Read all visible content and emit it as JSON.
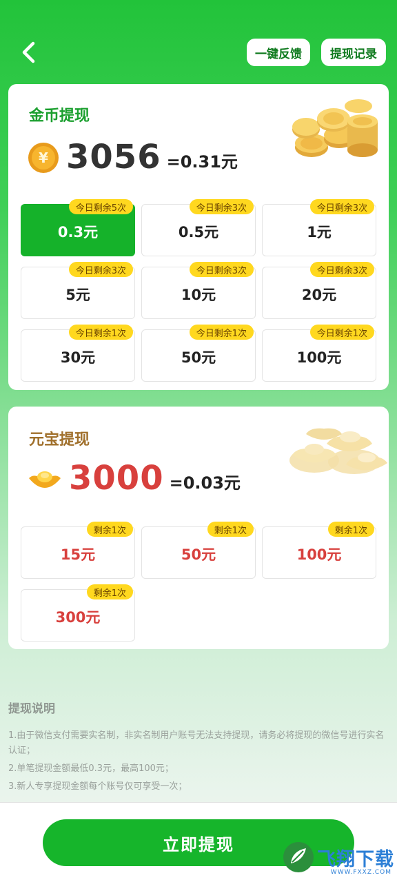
{
  "header": {
    "feedback_label": "一键反馈",
    "records_label": "提现记录"
  },
  "coin_section": {
    "title": "金币提现",
    "balance": "3056",
    "equivalent": "=0.31元",
    "options": [
      {
        "amount": "0.3元",
        "tag": "今日剩余5次",
        "selected": true
      },
      {
        "amount": "0.5元",
        "tag": "今日剩余3次"
      },
      {
        "amount": "1元",
        "tag": "今日剩余3次"
      },
      {
        "amount": "5元",
        "tag": "今日剩余3次"
      },
      {
        "amount": "10元",
        "tag": "今日剩余3次"
      },
      {
        "amount": "20元",
        "tag": "今日剩余3次"
      },
      {
        "amount": "30元",
        "tag": "今日剩余1次"
      },
      {
        "amount": "50元",
        "tag": "今日剩余1次"
      },
      {
        "amount": "100元",
        "tag": "今日剩余1次"
      }
    ]
  },
  "ingot_section": {
    "title": "元宝提现",
    "balance": "3000",
    "equivalent": "=0.03元",
    "options": [
      {
        "amount": "15元",
        "tag": "剩余1次"
      },
      {
        "amount": "50元",
        "tag": "剩余1次"
      },
      {
        "amount": "100元",
        "tag": "剩余1次"
      },
      {
        "amount": "300元",
        "tag": "剩余1次"
      }
    ]
  },
  "notes": {
    "title": "提现说明",
    "items": [
      "1.由于微信支付需要实名制，非实名制用户账号无法支持提现，请务必将提现的微信号进行实名认证；",
      "2.单笔提现金额最低0.3元，最高100元；",
      "3.新人专享提现金额每个账号仅可享受一次；"
    ]
  },
  "cta_label": "立即提现",
  "watermark": {
    "text": "飞翔下载",
    "sub": "WWW.FXXZ.COM"
  },
  "colors": {
    "primary_green": "#16b52b",
    "coin_title": "#1a9f2e",
    "ingot_title": "#a0702c",
    "ingot_amount": "#d8403d",
    "tag_yellow": "#ffd81f"
  }
}
